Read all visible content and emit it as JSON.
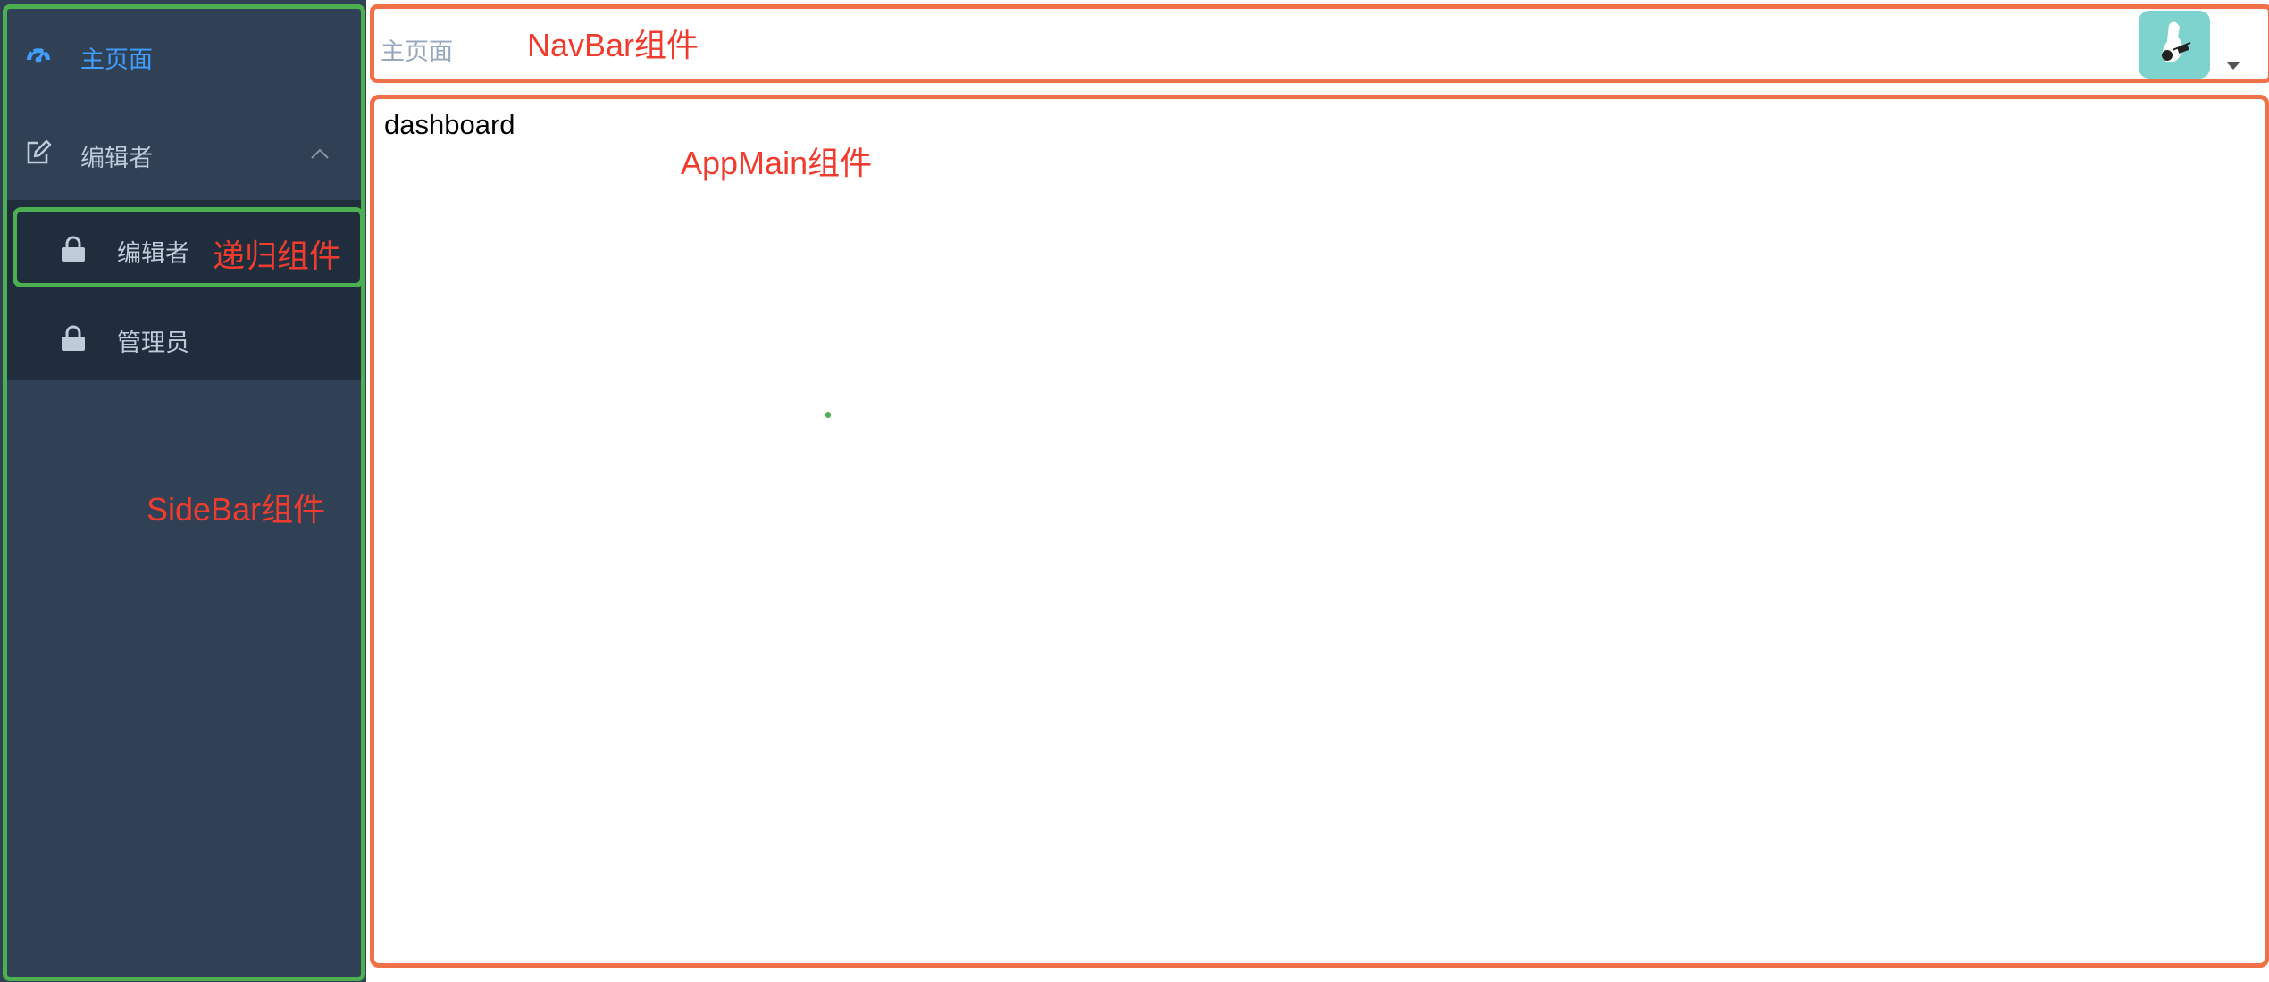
{
  "colors": {
    "sidebar_bg": "#304156",
    "submenu_bg": "#1f2d3d",
    "sidebar_text": "#bfcbd9",
    "active_text": "#409eff",
    "annotation_red": "#f03c2e",
    "frame_green": "#4caf50",
    "frame_orange": "#f07048",
    "avatar_bg": "#7fd3cf"
  },
  "sidebar": {
    "home": {
      "label": "主页面",
      "icon": "dashboard-icon",
      "active": true
    },
    "editor_group": {
      "label": "编辑者",
      "icon": "edit-icon",
      "expanded": true,
      "chevron_icon": "chevron-up-icon",
      "children": [
        {
          "label": "编辑者",
          "icon": "lock-icon"
        },
        {
          "label": "管理员",
          "icon": "lock-icon"
        }
      ]
    }
  },
  "navbar": {
    "breadcrumb": "主页面",
    "avatar_icon": "avatar-icon",
    "dropdown_icon": "caret-down-icon"
  },
  "main": {
    "content": "dashboard"
  },
  "annotations": {
    "navbar": "NavBar组件",
    "appmain": "AppMain组件",
    "recursive": "递归组件",
    "sidebar": "SideBar组件"
  }
}
